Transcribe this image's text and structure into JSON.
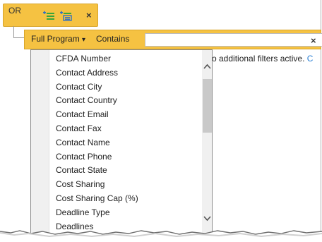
{
  "or_group": {
    "label": "OR",
    "icons": [
      "add-filter-icon",
      "add-group-icon",
      "close-icon"
    ],
    "close_glyph": "×"
  },
  "filter": {
    "field_label": "Full Program",
    "field_caret": "▾",
    "operator_label": "Contains",
    "value": "",
    "close_glyph": "×"
  },
  "status": {
    "text": "o additional filters active.",
    "link": "C"
  },
  "dropdown": {
    "options": [
      "CFDA Number",
      "Contact Address",
      "Contact City",
      "Contact Country",
      "Contact Email",
      "Contact Fax",
      "Contact Name",
      "Contact Phone",
      "Contact State",
      "Cost Sharing",
      "Cost Sharing Cap (%)",
      "Deadline Type",
      "Deadlines"
    ]
  },
  "colors": {
    "accent": "#f5c242",
    "accent_border": "#d8a52a",
    "icon_green": "#3aa53a",
    "icon_blue": "#2f6fc4",
    "link": "#2a7fd4"
  }
}
